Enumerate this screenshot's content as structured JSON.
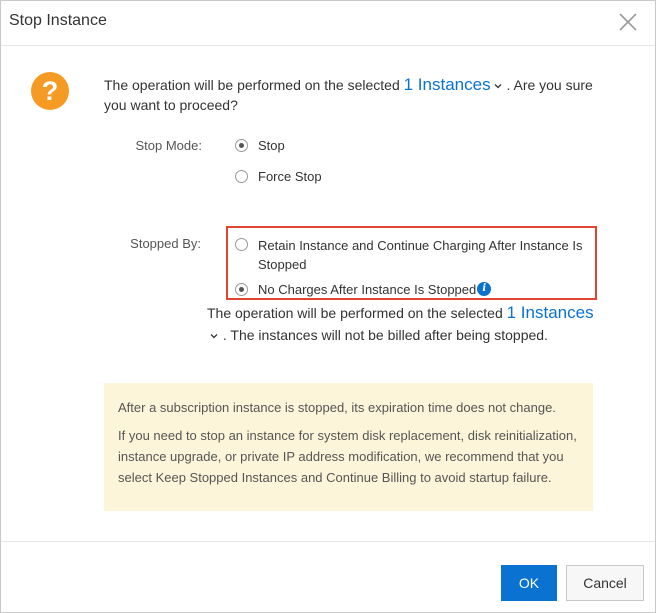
{
  "dialog": {
    "title": "Stop Instance"
  },
  "message": {
    "before": "The operation will be performed on the selected ",
    "instances_link": "1 Instances",
    "after": " . Are you sure you want to proceed?"
  },
  "stop_mode": {
    "label": "Stop Mode:",
    "options": [
      {
        "label": "Stop",
        "checked": true
      },
      {
        "label": "Force Stop",
        "checked": false
      }
    ]
  },
  "stopped_by": {
    "label": "Stopped By:",
    "options": [
      {
        "label": "Retain Instance and Continue Charging After Instance Is Stopped",
        "checked": false
      },
      {
        "label": "No Charges After Instance Is Stopped",
        "checked": true
      }
    ]
  },
  "note": {
    "before": "The operation will be performed on the selected ",
    "instances_link": "1 Instances",
    "after": " . The instances will not be billed after being stopped."
  },
  "tip": {
    "line1": "After a subscription instance is stopped, its expiration time does not change.",
    "line2": "If you need to stop an instance for system disk replacement, disk reinitialization, instance upgrade, or private IP address modification, we recommend that you select Keep Stopped Instances and Continue Billing to avoid startup failure."
  },
  "footer": {
    "ok_label": "OK",
    "cancel_label": "Cancel"
  },
  "colors": {
    "accent": "#0a72d1",
    "warning": "#f59b23",
    "highlight_border": "#e0452f",
    "tip_background": "#fdf5d9"
  },
  "icons": {
    "close": "close-icon",
    "warning": "question-circle-icon",
    "info": "info-icon",
    "dropdown": "chevron-down-icon"
  }
}
